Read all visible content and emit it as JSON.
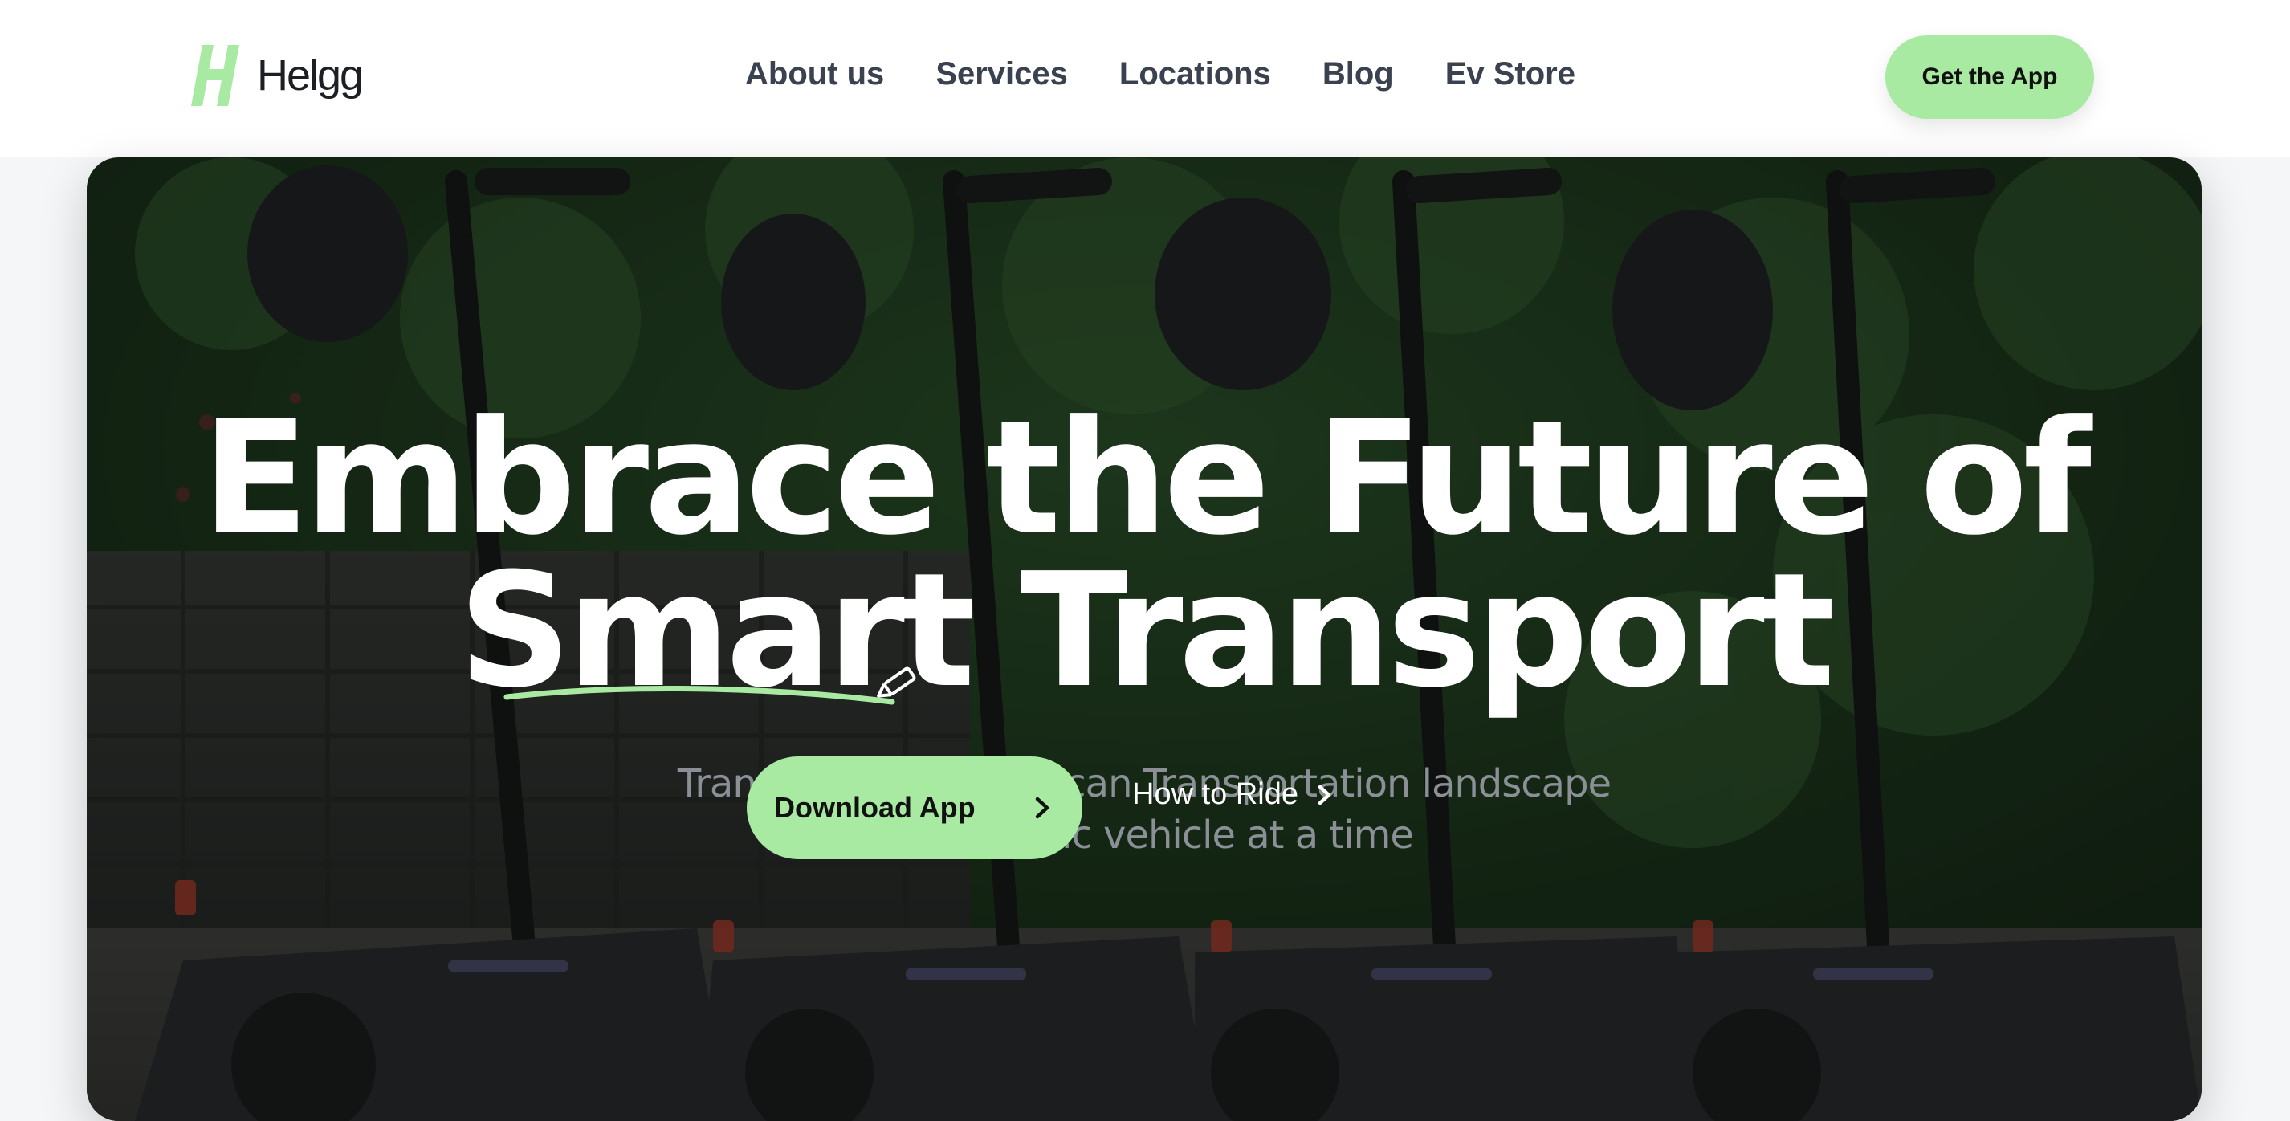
{
  "brand": {
    "name": "Helgg",
    "logo_icon": "helgg-h-logo-icon",
    "accent_color": "#a9eaa3"
  },
  "nav": {
    "items": [
      {
        "label": "About us"
      },
      {
        "label": "Services"
      },
      {
        "label": "Locations"
      },
      {
        "label": "Blog"
      },
      {
        "label": "Ev Store"
      }
    ]
  },
  "header": {
    "cta_label": "Get the App"
  },
  "hero": {
    "background_image": "electric-scooters-with-helmets-photo",
    "headline": {
      "line1": "Embrace the Future of",
      "line2_highlight": "Smart",
      "line2_rest": " Transport"
    },
    "subtitle": {
      "line1": "Transforming the African Transportation landscape",
      "line2": "one electric vehicle at a time"
    },
    "primary_button": {
      "label": "Download App",
      "icon": "chevron-right-icon"
    },
    "secondary_button": {
      "label": "How to Ride",
      "icon": "chevron-right-icon"
    }
  }
}
